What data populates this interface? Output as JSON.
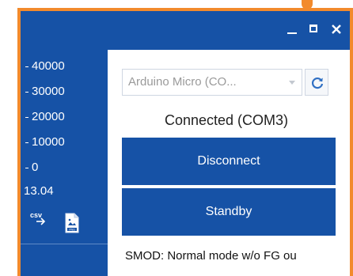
{
  "window": {
    "controls": {
      "minimize_icon": "minimize-icon",
      "maximize_icon": "maximize-icon",
      "close_icon": "close-icon"
    },
    "frame_color": "#f28a2c",
    "accent_color": "#1652a6"
  },
  "chart_panel": {
    "y_ticks": [
      "40000",
      "30000",
      "20000",
      "10000",
      "0"
    ],
    "x_readout": "13.04",
    "export_csv_label": "csv",
    "export_png_label": "PNG"
  },
  "connection": {
    "device_select": {
      "value": "Arduino Micro (CO..."
    },
    "refresh_icon": "refresh-icon",
    "status": "Connected (COM3)",
    "disconnect_label": "Disconnect",
    "standby_label": "Standby",
    "smod_text": "SMOD: Normal mode w/o FG ou"
  }
}
